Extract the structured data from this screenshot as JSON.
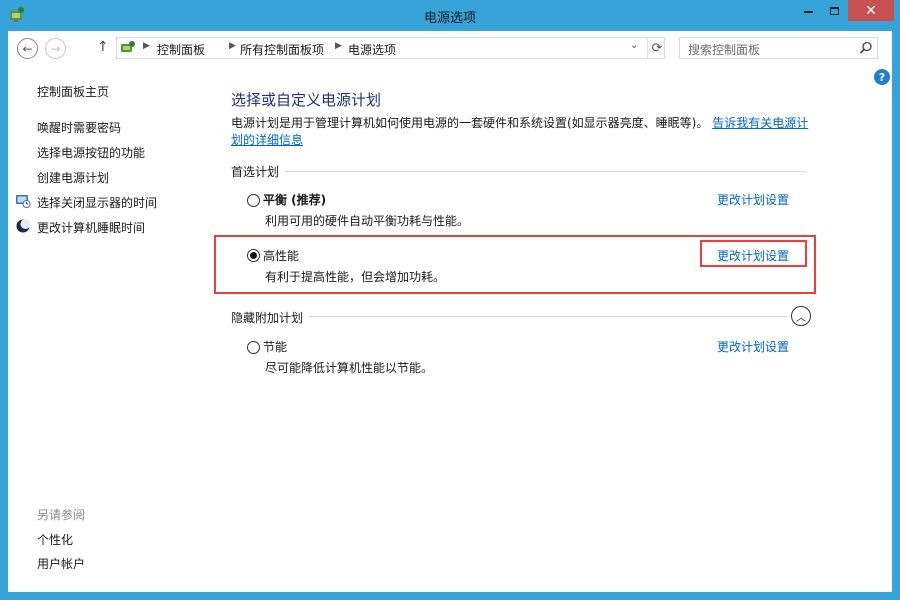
{
  "window": {
    "title": "电源选项",
    "close_glyph": "✕"
  },
  "nav": {
    "back_glyph": "←",
    "forward_glyph": "→",
    "up_glyph": "↑",
    "breadcrumbs": [
      "控制面板",
      "所有控制面板项",
      "电源选项"
    ],
    "refresh_glyph": "⟳",
    "search_placeholder": "搜索控制面板"
  },
  "help": {
    "glyph": "?"
  },
  "sidebar": {
    "home": "控制面板主页",
    "tasks": [
      {
        "label": "唤醒时需要密码",
        "icon": ""
      },
      {
        "label": "选择电源按钮的功能",
        "icon": ""
      },
      {
        "label": "创建电源计划",
        "icon": ""
      },
      {
        "label": "选择关闭显示器的时间",
        "icon": "monitor-clock-icon"
      },
      {
        "label": "更改计算机睡眠时间",
        "icon": "moon-icon"
      }
    ],
    "see_also_title": "另请参阅",
    "see_also": [
      "个性化",
      "用户帐户"
    ]
  },
  "main": {
    "heading": "选择或自定义电源计划",
    "description": "电源计划是用于管理计算机如何使用电源的一套硬件和系统设置(如显示器亮度、睡眠等)。",
    "description_link": "告诉我有关电源计划的详细信息",
    "preferred_label": "首选计划",
    "hidden_label": "隐藏附加计划",
    "plans": [
      {
        "name": "平衡 (推荐)",
        "desc": "利用可用的硬件自动平衡功耗与性能。",
        "link": "更改计划设置",
        "selected": false
      },
      {
        "name": "高性能",
        "desc": "有利于提高性能，但会增加功耗。",
        "link": "更改计划设置",
        "selected": true
      },
      {
        "name": "节能",
        "desc": "尽可能降低计算机性能以节能。",
        "link": "更改计划设置",
        "selected": false
      }
    ]
  },
  "colors": {
    "titlebar": "#36a3d9",
    "close_button": "#c75050",
    "heading": "#1e3287",
    "link": "#0066cc",
    "highlight": "#e8403a"
  }
}
